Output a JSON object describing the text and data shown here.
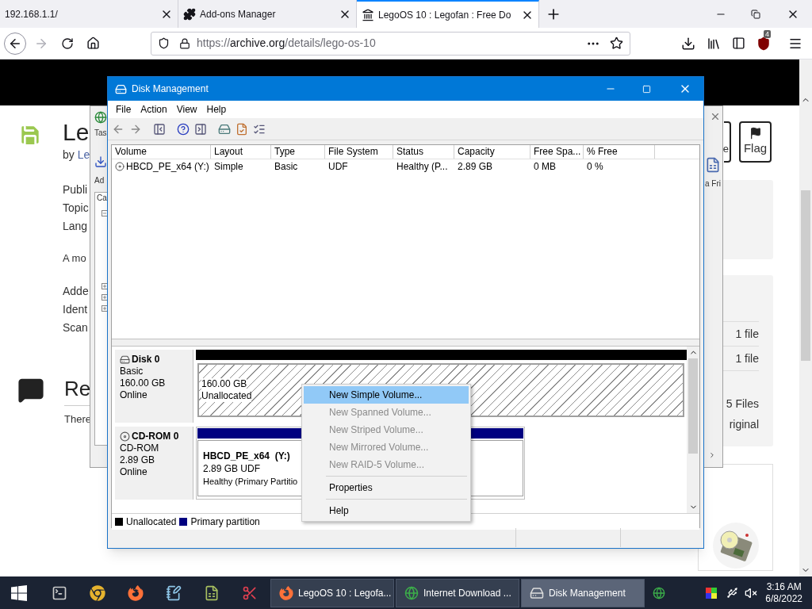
{
  "browser": {
    "tabs": [
      {
        "title": "192.168.1.1/",
        "selected": false
      },
      {
        "title": "Add-ons Manager",
        "selected": false
      },
      {
        "title": "LegoOS 10 : Legofan : Free Do",
        "selected": true
      }
    ],
    "nav": {
      "forward_disabled": true
    },
    "url": {
      "scheme": "https://",
      "host": "archive.org",
      "path": "/details/lego-os-10"
    },
    "extension_badge": "4"
  },
  "page": {
    "title": "Le",
    "byline": "by",
    "author": "Le",
    "meta": [
      "Publi",
      "Topic",
      "Lang"
    ],
    "description": "A mo",
    "details": [
      "Adde",
      "Ident",
      "Scan"
    ],
    "reviews_title": "Re",
    "reviews_text": "There",
    "share_label": "e",
    "flag_label": "Flag",
    "files": [
      "1 file",
      "1 file"
    ],
    "total_files": "5 Files",
    "original": "riginal"
  },
  "background_window": {
    "labels": [
      "Tas",
      "Ad",
      "Ca"
    ],
    "toolbar_label": "a Fri"
  },
  "disk_management": {
    "title": "Disk Management",
    "menu": [
      "File",
      "Action",
      "View",
      "Help"
    ],
    "columns": [
      "Volume",
      "Layout",
      "Type",
      "File System",
      "Status",
      "Capacity",
      "Free Spa...",
      "% Free"
    ],
    "volumes": [
      {
        "cells": [
          "HBCD_PE_x64 (Y:)",
          "Simple",
          "Basic",
          "UDF",
          "Healthy (P...",
          "2.89 GB",
          "0 MB",
          "0 %"
        ]
      }
    ],
    "disks": [
      {
        "name": "Disk 0",
        "kind": "hdd",
        "type": "Basic",
        "size": "160.00 GB",
        "status": "Online",
        "partition": {
          "kind": "unallocated",
          "size": "160.00 GB",
          "label": "Unallocated"
        }
      },
      {
        "name": "CD-ROM 0",
        "kind": "cdrom",
        "type": "CD-ROM",
        "size": "2.89 GB",
        "status": "Online",
        "partition": {
          "kind": "primary",
          "name": "HBCD_PE_x64  (Y:)",
          "size": "2.89 GB UDF",
          "status": "Healthy (Primary Partitio"
        }
      }
    ],
    "legend": [
      {
        "label": "Unallocated",
        "color": "#000000"
      },
      {
        "label": "Primary partition",
        "color": "#000080"
      }
    ]
  },
  "context_menu": {
    "items": [
      {
        "kind": "item",
        "label": "New Simple Volume...",
        "selected": true,
        "disabled": false
      },
      {
        "kind": "item",
        "label": "New Spanned Volume...",
        "selected": false,
        "disabled": true
      },
      {
        "kind": "item",
        "label": "New Striped Volume...",
        "selected": false,
        "disabled": true
      },
      {
        "kind": "item",
        "label": "New Mirrored Volume...",
        "selected": false,
        "disabled": true
      },
      {
        "kind": "item",
        "label": "New RAID-5 Volume...",
        "selected": false,
        "disabled": true
      },
      {
        "kind": "separator"
      },
      {
        "kind": "item",
        "label": "Properties",
        "selected": false,
        "disabled": false
      },
      {
        "kind": "separator"
      },
      {
        "kind": "item",
        "label": "Help",
        "selected": false,
        "disabled": false
      }
    ]
  },
  "taskbar": {
    "apps": [
      {
        "label": "LegoOS 10 : Legofa...",
        "selected": false
      },
      {
        "label": "Internet Download ...",
        "selected": false
      },
      {
        "label": "Disk Management",
        "selected": true
      }
    ],
    "time": "3:16 AM",
    "date": "6/8/2022"
  }
}
